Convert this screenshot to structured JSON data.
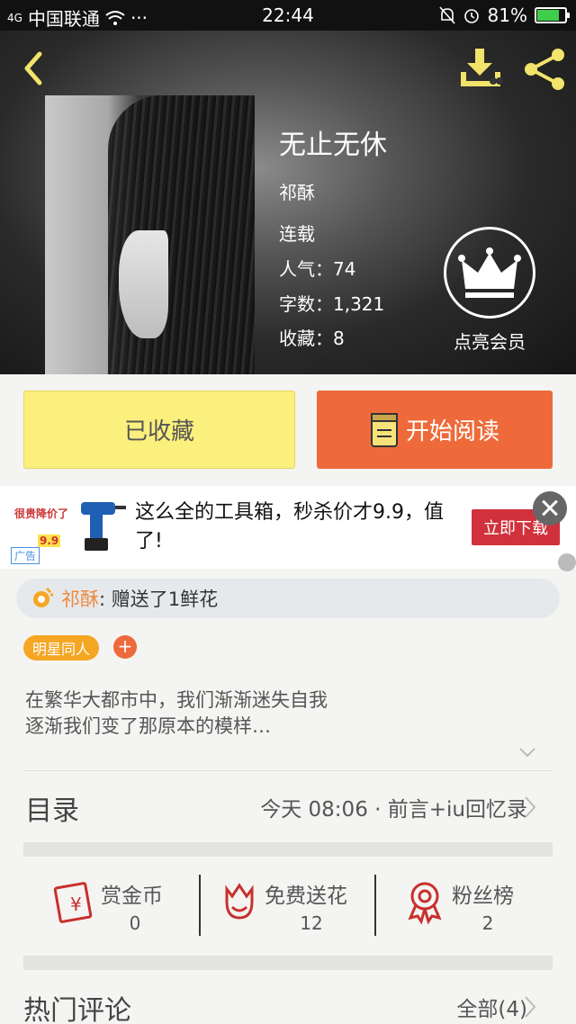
{
  "status_bar": {
    "signal": "4G",
    "carrier": "中国联通",
    "more": "···",
    "time": "22:44",
    "battery": "81%",
    "battery_level": 0.81
  },
  "header": {
    "back_icon": "chevron-left-icon",
    "download_icon": "download-icon",
    "share_icon": "share-icon",
    "accent_color": "#f2e36b"
  },
  "book": {
    "title": "无止无休",
    "author": "祁酥",
    "status": "连载",
    "popularity": "人气：74",
    "word_count": "字数：1,321",
    "favorites": "收藏：8"
  },
  "vip": {
    "icon": "crown-icon",
    "label": "点亮会员"
  },
  "actions": {
    "favorited_label": "已收藏",
    "read_label": "开始阅读",
    "read_icon": "book-icon"
  },
  "ad": {
    "image_top_text": "很贵降价了",
    "image_price": "9.9",
    "badge": "广告",
    "text": "这么全的工具箱，秒杀价才9.9，值了!",
    "cta": "立即下载",
    "close_icon": "close-icon"
  },
  "flower_gift": {
    "icon": "flower-icon",
    "user": "祁酥",
    "message": ": 赠送了1鲜花"
  },
  "tags": {
    "items": [
      "明星同人"
    ],
    "add": "+"
  },
  "intro": {
    "line1": "在繁华大都市中，我们渐渐迷失自我",
    "line2": "逐渐我们变了那原本的模样…"
  },
  "toc": {
    "label": "目录",
    "latest": "今天 08:06 · 前言+iu回忆录"
  },
  "stats": [
    {
      "icon": "red-envelope-icon",
      "label": "赏金币",
      "value": "0"
    },
    {
      "icon": "flower-face-icon",
      "label": "免费送花",
      "value": "12"
    },
    {
      "icon": "medal-icon",
      "label": "粉丝榜",
      "value": "2"
    }
  ],
  "comments": {
    "label": "热门评论",
    "all": "全部(4)"
  }
}
